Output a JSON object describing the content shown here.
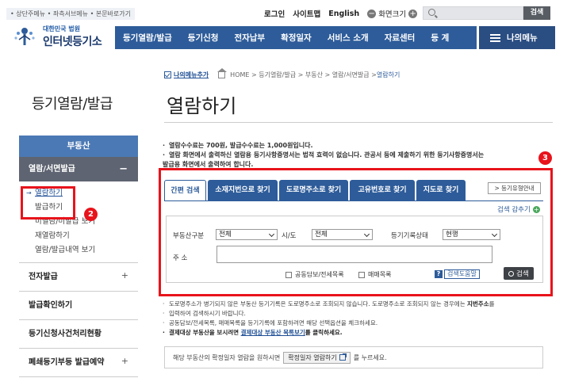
{
  "skip_links": "• 상단주메뉴 • 좌측서브메뉴 • 본문바로가기",
  "utility": {
    "login": "로그인",
    "sitemap": "사이트맵",
    "english": "English",
    "zoom_label": "화면크기",
    "search_button": "검색"
  },
  "logo": {
    "sub": "대한민국 법원",
    "main": "인터넷등기소"
  },
  "gnb": [
    "등기열람/발급",
    "등기신청",
    "전자납부",
    "확정일자",
    "서비스 소개",
    "자료센터",
    "등 계"
  ],
  "my_menu": "나의메뉴",
  "breadcrumb": {
    "add_menu": "나의메뉴추가",
    "path": "HOME > 등기열람/발급 > 부동산 > 열람/서면발급 > ",
    "current": "열람하기"
  },
  "side_title": "등기열람/발급",
  "page_title": "열람하기",
  "lnb": {
    "head": "부동산",
    "active": "열람/서면발급",
    "active_sign": "−",
    "sub": [
      "열람하기",
      "발급하기",
      "미열람/미발급 보기",
      "재열람하기",
      "열람/발급내역 보기"
    ],
    "items": [
      {
        "label": "전자발급",
        "sign": "+"
      },
      {
        "label": "발급확인하기",
        "sign": ""
      },
      {
        "label": "등기신청사건처리현황",
        "sign": ""
      },
      {
        "label": "폐쇄등기부등 발급예약",
        "sign": "+"
      }
    ]
  },
  "annotations": {
    "box2": "2",
    "box3": "3"
  },
  "info": [
    "열람수수료는 700원, 발급수수료는 1,000원입니다.",
    "열람 화면에서 출력하신 열람용 등기사항증명서는 법적 효력이 없습니다. 관공서 등에 제출하기 위한 등기사항증명서는",
    "발급용 화면에서 출력하여 합니다."
  ],
  "tabs": [
    "간편 검색",
    "소재지번으로 찾기",
    "도로명주소로 찾기",
    "고유번호로 찾기",
    "지도로 찾기"
  ],
  "guide_button": "> 등기유형안내",
  "fold_label": "검색 감추기",
  "form": {
    "type_label": "부동산구분",
    "type_value": "전체",
    "region_label": "시/도",
    "region_value": "전체",
    "status_label": "등기기록상태",
    "status_value": "현행",
    "address_label": "주 소",
    "address_value": "",
    "cb1": "공동담보/전세목록",
    "cb2": "매매목록",
    "help_q": "?",
    "help": "검색도움말",
    "search": "검색"
  },
  "notes": {
    "n1a": "도로명주소가 병기되지 않은 부동산 등기기록은 도로명주소로 조회되지 않습니다. 도로명주소로 조회되지 않는 경우에는 ",
    "n1b": "지번주소",
    "n1c": "를",
    "n2": "입력하여 검색하시기 바랍니다.",
    "n3": "공동담보/전세목록, 매매목록을 등기기록에 포함하려면 해당 선택옵션을 체크하세요.",
    "n4a": "결제대상 부동산을 보시려면 ",
    "n4b": "결제대상 부동산 목록보기",
    "n4c": "를 클릭하세요."
  },
  "notebox": {
    "pre": "해당 부동산의 확정일자 열람을 원하시면",
    "button": "확정일자 열람하기",
    "post": "를 누르세요."
  }
}
